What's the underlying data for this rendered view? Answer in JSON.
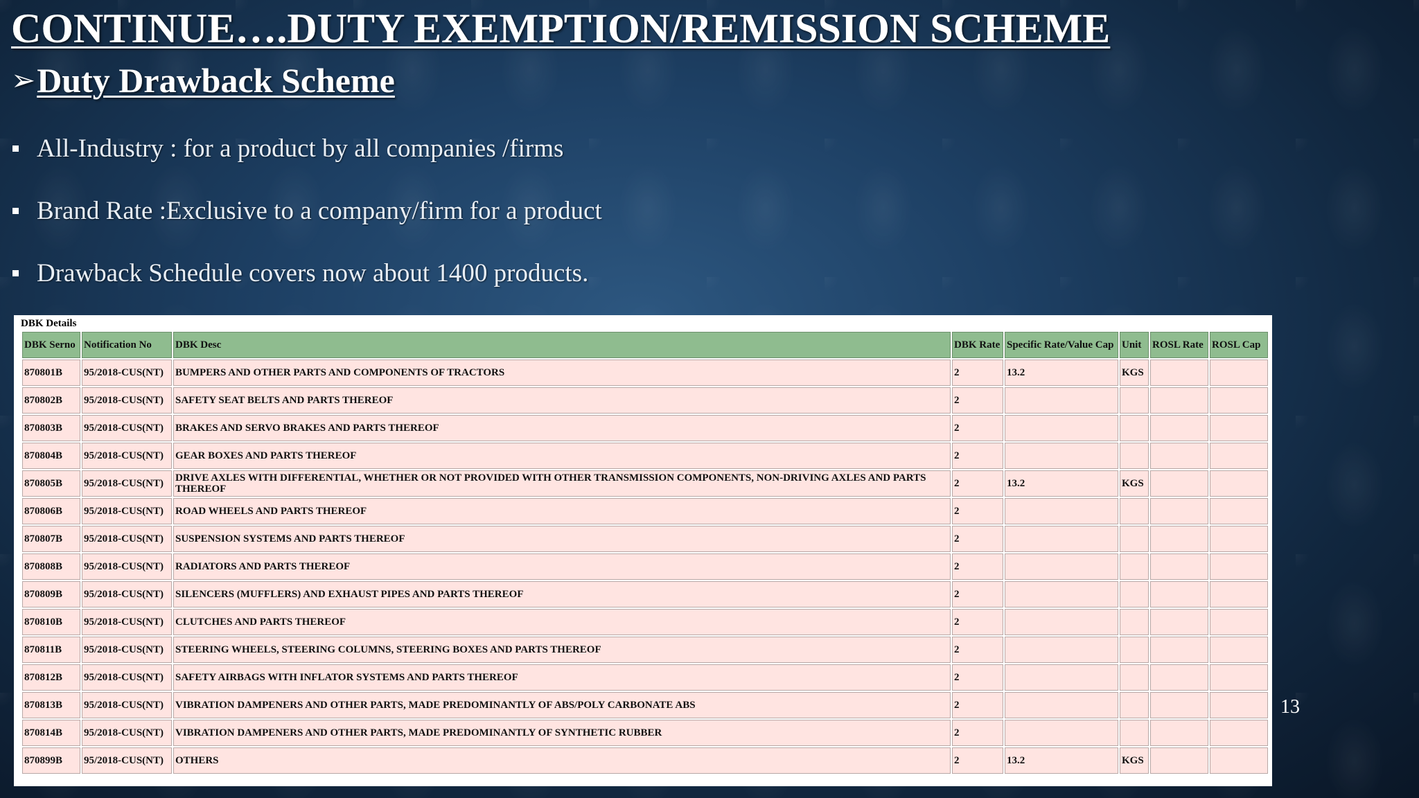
{
  "slide": {
    "title": "CONTINUE….DUTY EXEMPTION/REMISSION SCHEME",
    "subtitle_arrow": "➢",
    "subtitle": "Duty Drawback Scheme",
    "bullets": [
      "All-Industry : for a product by all companies /firms",
      "Brand Rate :Exclusive to  a company/firm for a product",
      "Drawback Schedule covers now about 1400 products."
    ],
    "page_number": "13"
  },
  "dbk_table": {
    "caption": "DBK Details",
    "headers": [
      "DBK Serno",
      "Notification No",
      "DBK Desc",
      "DBK Rate",
      "Specific Rate/Value Cap",
      "Unit",
      "ROSL Rate",
      "ROSL Cap"
    ],
    "rows": [
      [
        "870801B",
        "95/2018-CUS(NT)",
        "BUMPERS AND OTHER PARTS AND COMPONENTS OF TRACTORS",
        "2",
        "13.2",
        "KGS",
        "",
        ""
      ],
      [
        "870802B",
        "95/2018-CUS(NT)",
        "SAFETY SEAT BELTS AND PARTS THEREOF",
        "2",
        "",
        "",
        "",
        ""
      ],
      [
        "870803B",
        "95/2018-CUS(NT)",
        "BRAKES AND SERVO BRAKES AND PARTS THEREOF",
        "2",
        "",
        "",
        "",
        ""
      ],
      [
        "870804B",
        "95/2018-CUS(NT)",
        "GEAR BOXES AND PARTS THEREOF",
        "2",
        "",
        "",
        "",
        ""
      ],
      [
        "870805B",
        "95/2018-CUS(NT)",
        "DRIVE AXLES WITH DIFFERENTIAL, WHETHER OR NOT PROVIDED WITH OTHER TRANSMISSION COMPONENTS, NON-DRIVING AXLES AND PARTS THEREOF",
        "2",
        "13.2",
        "KGS",
        "",
        ""
      ],
      [
        "870806B",
        "95/2018-CUS(NT)",
        "ROAD WHEELS AND PARTS THEREOF",
        "2",
        "",
        "",
        "",
        ""
      ],
      [
        "870807B",
        "95/2018-CUS(NT)",
        "SUSPENSION SYSTEMS AND PARTS THEREOF",
        "2",
        "",
        "",
        "",
        ""
      ],
      [
        "870808B",
        "95/2018-CUS(NT)",
        "RADIATORS AND PARTS THEREOF",
        "2",
        "",
        "",
        "",
        ""
      ],
      [
        "870809B",
        "95/2018-CUS(NT)",
        "SILENCERS (MUFFLERS) AND EXHAUST PIPES AND PARTS THEREOF",
        "2",
        "",
        "",
        "",
        ""
      ],
      [
        "870810B",
        "95/2018-CUS(NT)",
        "CLUTCHES AND PARTS THEREOF",
        "2",
        "",
        "",
        "",
        ""
      ],
      [
        "870811B",
        "95/2018-CUS(NT)",
        "STEERING WHEELS, STEERING COLUMNS, STEERING BOXES AND PARTS THEREOF",
        "2",
        "",
        "",
        "",
        ""
      ],
      [
        "870812B",
        "95/2018-CUS(NT)",
        "SAFETY AIRBAGS WITH INFLATOR SYSTEMS AND PARTS THEREOF",
        "2",
        "",
        "",
        "",
        ""
      ],
      [
        "870813B",
        "95/2018-CUS(NT)",
        "VIBRATION DAMPENERS AND OTHER PARTS, MADE PREDOMINANTLY OF ABS/POLY CARBONATE ABS",
        "2",
        "",
        "",
        "",
        ""
      ],
      [
        "870814B",
        "95/2018-CUS(NT)",
        "VIBRATION DAMPENERS AND OTHER PARTS, MADE PREDOMINANTLY OF SYNTHETIC RUBBER",
        "2",
        "",
        "",
        "",
        ""
      ],
      [
        "870899B",
        "95/2018-CUS(NT)",
        "OTHERS",
        "2",
        "13.2",
        "KGS",
        "",
        ""
      ]
    ]
  }
}
